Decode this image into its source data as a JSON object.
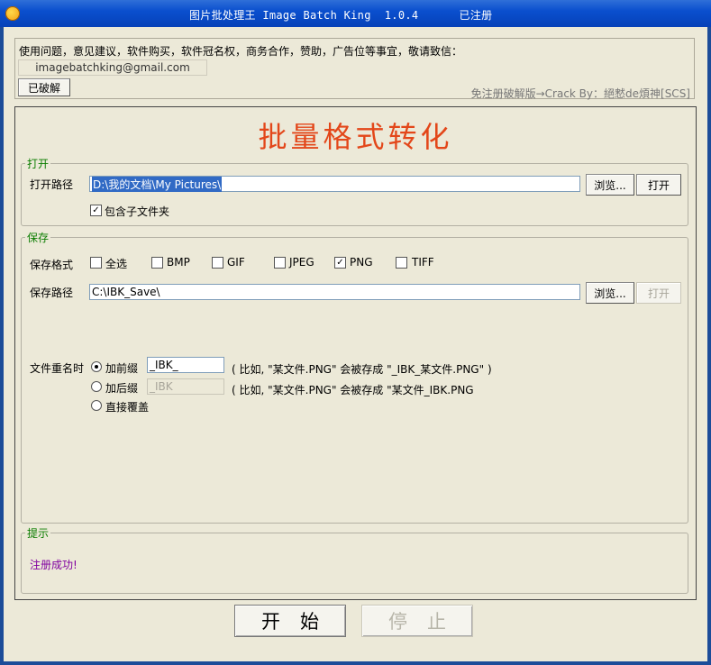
{
  "window": {
    "title": "图片批处理王 Image Batch King  1.0.4      已注册"
  },
  "contact": {
    "text": "使用问题，意见建议，软件购买，软件冠名权，商务合作，赞助，广告位等事宜，敬请致信：",
    "email": "imagebatchking@gmail.com",
    "cracked_button": "已破解",
    "crack_note": "免注册破解版→Crack By：絕慭de煩神[SCS]"
  },
  "main": {
    "title": "批量格式转化"
  },
  "open_group": {
    "legend": "打开",
    "path_label": "打开路径",
    "path_value": "D:\\我的文档\\My Pictures\\",
    "browse_label": "浏览...",
    "open_label": "打开",
    "include_subfolders_label": "包含子文件夹",
    "include_subfolders_checked": true
  },
  "save_group": {
    "legend": "保存",
    "format_label": "保存格式",
    "formats": [
      {
        "label": "全选",
        "checked": false
      },
      {
        "label": "BMP",
        "checked": false
      },
      {
        "label": "GIF",
        "checked": false
      },
      {
        "label": "JPEG",
        "checked": false
      },
      {
        "label": "PNG",
        "checked": true
      },
      {
        "label": "TIFF",
        "checked": false
      }
    ],
    "path_label": "保存路径",
    "path_value": "C:\\IBK_Save\\",
    "browse_label": "浏览...",
    "open_label": "打开",
    "rename_label": "文件重名时",
    "rename_options": [
      {
        "label": "加前缀",
        "value": "_IBK_",
        "example": "( 比如, \"某文件.PNG\" 会被存成 \"_IBK_某文件.PNG\" )",
        "selected": true
      },
      {
        "label": "加后缀",
        "value": "_IBK",
        "example": "( 比如, \"某文件.PNG\" 会被存成 \"某文件_IBK.PNG",
        "selected": false
      },
      {
        "label": "直接覆盖",
        "selected": false
      }
    ]
  },
  "hint_group": {
    "legend": "提示",
    "status": "注册成功!"
  },
  "actions": {
    "start_label": "开始",
    "stop_label": "停止"
  },
  "colors": {
    "title_red": "#e3471a",
    "legend_green": "#0b7d00",
    "status_purple": "#8000a0"
  }
}
